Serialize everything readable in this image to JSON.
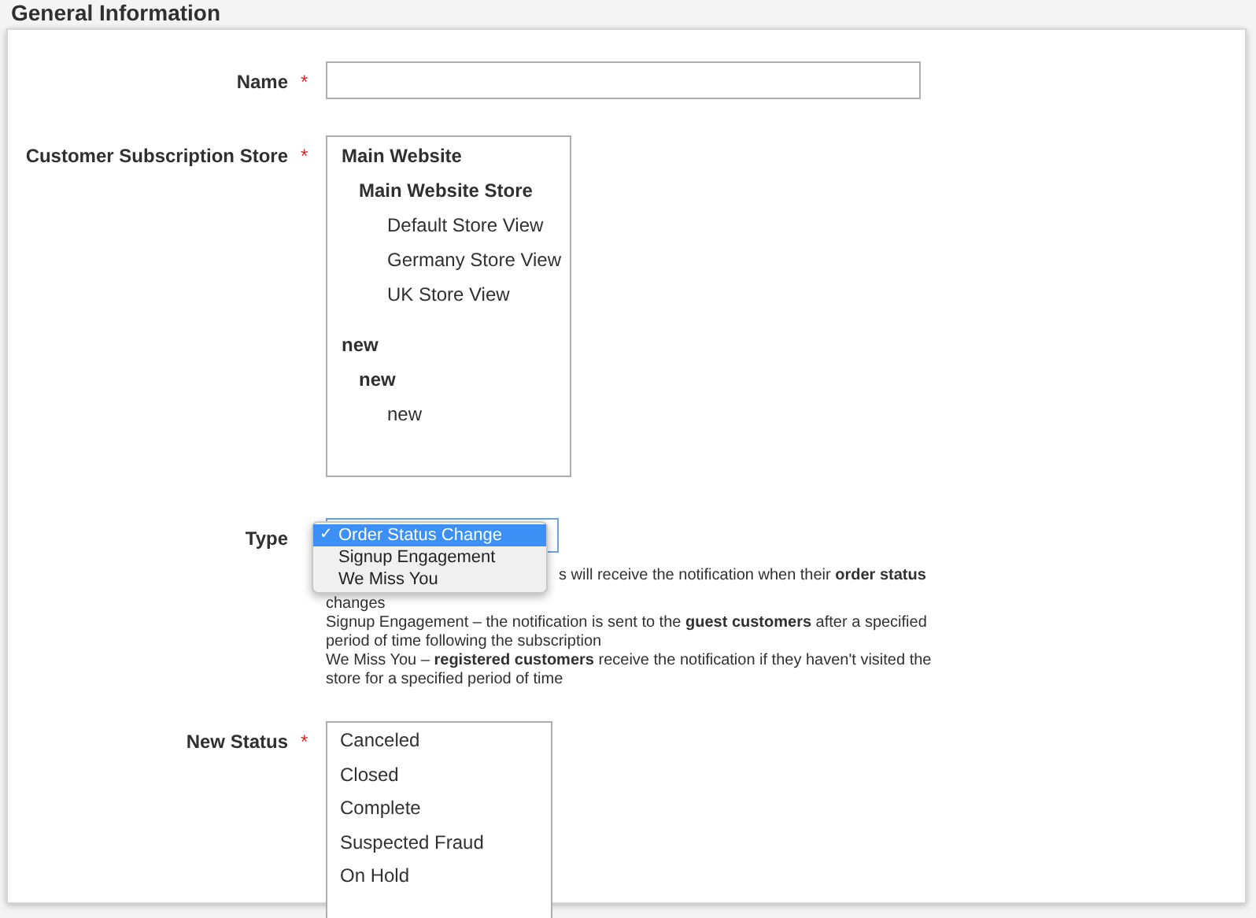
{
  "section_title": "General Information",
  "name_field": {
    "label": "Name",
    "required_mark": "*"
  },
  "store_field": {
    "label": "Customer Subscription Store",
    "required_mark": "*",
    "tree": [
      {
        "label": "Main Website",
        "children": [
          {
            "label": "Main Website Store",
            "children": [
              {
                "label": "Default Store View"
              },
              {
                "label": "Germany Store View"
              },
              {
                "label": "UK Store View"
              }
            ]
          }
        ]
      },
      {
        "label": "new",
        "children": [
          {
            "label": "new",
            "children": [
              {
                "label": "new"
              }
            ]
          }
        ]
      }
    ]
  },
  "type_field": {
    "label": "Type",
    "check_mark": "✓",
    "options": [
      {
        "label": "Order Status Change",
        "selected": true
      },
      {
        "label": "Signup Engagement",
        "selected": false
      },
      {
        "label": "We Miss You",
        "selected": false
      }
    ],
    "description": [
      "s will receive the notification when their **order status**",
      "changes",
      "Signup Engagement – the notification is sent to the **guest customers** after a specified period of time following the subscription",
      "We Miss You – **registered customers** receive the notification if they haven't visited the store for a specified period of time"
    ]
  },
  "status_field": {
    "label": "New Status",
    "required_mark": "*",
    "options": [
      "Canceled",
      "Closed",
      "Complete",
      "Suspected Fraud",
      "On Hold"
    ]
  }
}
